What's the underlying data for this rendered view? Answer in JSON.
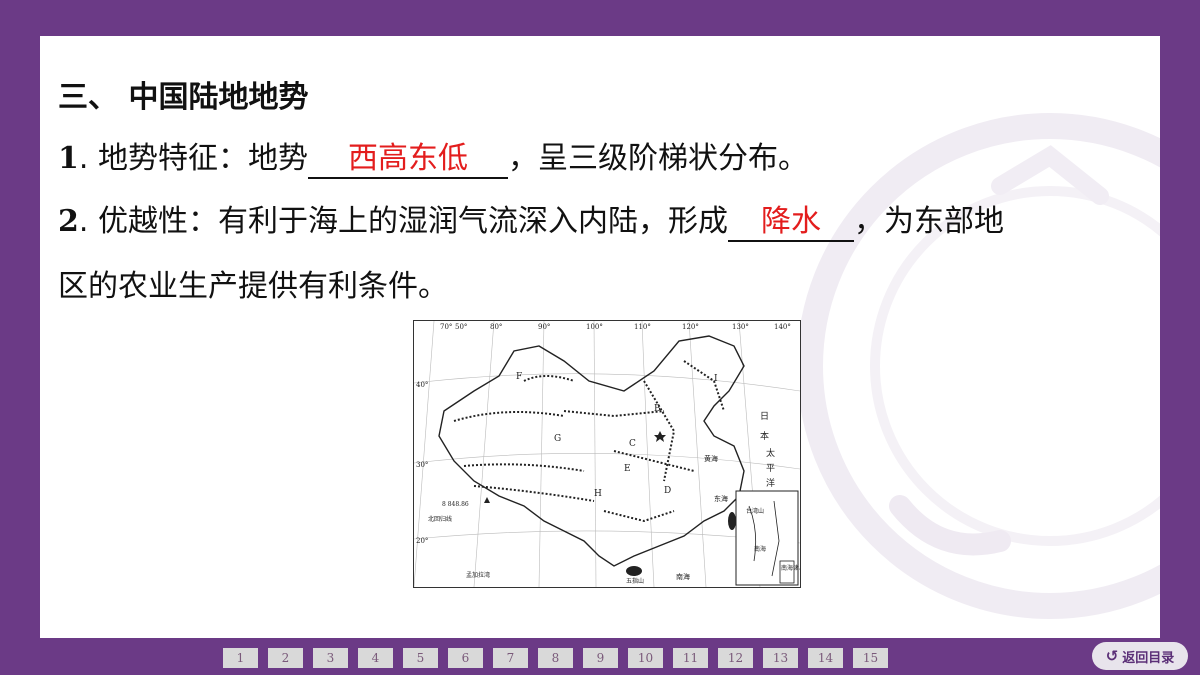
{
  "section_title": "三、 中国陆地地势",
  "item1": {
    "num": "1",
    "prefix": ". 地势特征：地势",
    "answer": "西高东低",
    "suffix": "，呈三级阶梯状分布。"
  },
  "item2": {
    "num": "2",
    "prefix": ". 优越性：有利于海上的湿润气流深入内陆，形成",
    "answer": "降水",
    "suffix": "，为东部地",
    "continuation": "区的农业生产提供有利条件。"
  },
  "map": {
    "longitudes": [
      "70°",
      "50°",
      "80°",
      "90°",
      "100°",
      "110°",
      "120°",
      "130°",
      "140°"
    ],
    "latitudes": [
      "40°",
      "30°",
      "20°"
    ],
    "labels": [
      "F",
      "B",
      "G",
      "E",
      "H",
      "D",
      "C",
      "I",
      "日",
      "本",
      "太",
      "平",
      "洋",
      "黄海",
      "东海",
      "南海",
      "8 848.86",
      "北回归线",
      "孟加拉湾",
      "五指山",
      "南海诸岛",
      "台湾山",
      "南海"
    ],
    "inset_label": "南海诸岛"
  },
  "pager": [
    "1",
    "2",
    "3",
    "4",
    "5",
    "6",
    "7",
    "8",
    "9",
    "10",
    "11",
    "12",
    "13",
    "14",
    "15"
  ],
  "back_button": "返回目录"
}
